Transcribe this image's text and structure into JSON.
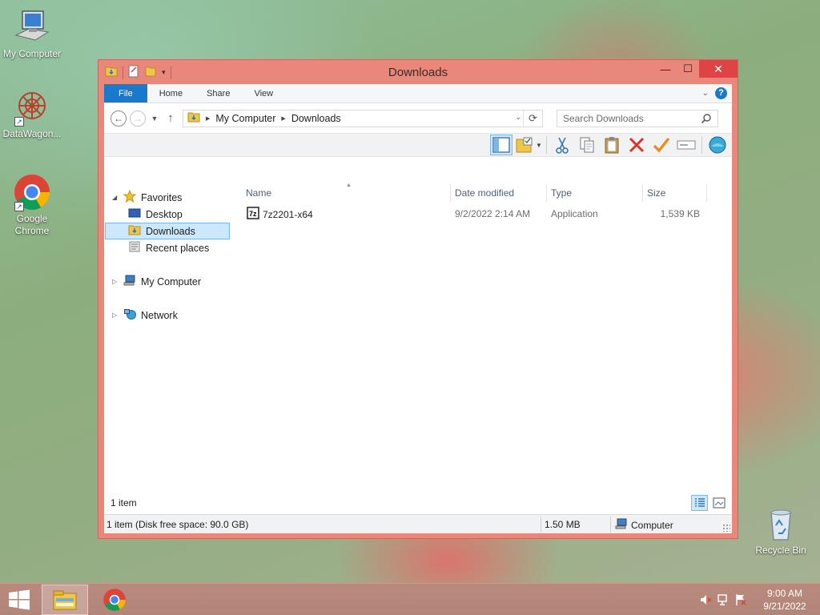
{
  "desktop": {
    "icons": [
      {
        "label": "My Computer",
        "icon": "computer-icon"
      },
      {
        "label": "DataWagon...",
        "icon": "datawagon-icon"
      },
      {
        "label": "Google Chrome",
        "icon": "chrome-icon"
      },
      {
        "label": "Recycle Bin",
        "icon": "recycle-bin-icon"
      }
    ]
  },
  "window": {
    "title": "Downloads",
    "controls": {
      "minimize": "—",
      "maximize": "☐",
      "close": "✕"
    },
    "ribbon_tabs": [
      "File",
      "Home",
      "Share",
      "View"
    ],
    "address": {
      "crumbs": [
        "My Computer",
        "Downloads"
      ]
    },
    "search": {
      "placeholder": "Search Downloads"
    },
    "nav_pane": {
      "favorites": {
        "label": "Favorites",
        "items": [
          "Desktop",
          "Downloads",
          "Recent places"
        ],
        "selected": "Downloads"
      },
      "my_computer": "My Computer",
      "network": "Network"
    },
    "columns": [
      "Name",
      "Date modified",
      "Type",
      "Size"
    ],
    "files": [
      {
        "name": "7z2201-x64",
        "date_modified": "9/2/2022 2:14 AM",
        "type": "Application",
        "size": "1,539 KB",
        "icon": "7zip-installer-icon"
      }
    ],
    "status": {
      "item_count": "1 item"
    },
    "details_bar": {
      "selection": "1 item (Disk free space: 90.0 GB)",
      "size": "1.50 MB",
      "location": "Computer"
    }
  },
  "taskbar": {
    "clock": {
      "time": "9:00 AM",
      "date": "9/21/2022"
    },
    "apps": [
      "file-explorer-icon",
      "chrome-icon"
    ],
    "tray": [
      "volume-muted-icon",
      "network-icon",
      "action-center-flag-icon"
    ]
  },
  "colors": {
    "titlebar": "#e9877a",
    "close_button": "#e04343",
    "file_tab": "#1979ca",
    "selection": "#cce8ff",
    "taskbar": "#b98a7c"
  }
}
